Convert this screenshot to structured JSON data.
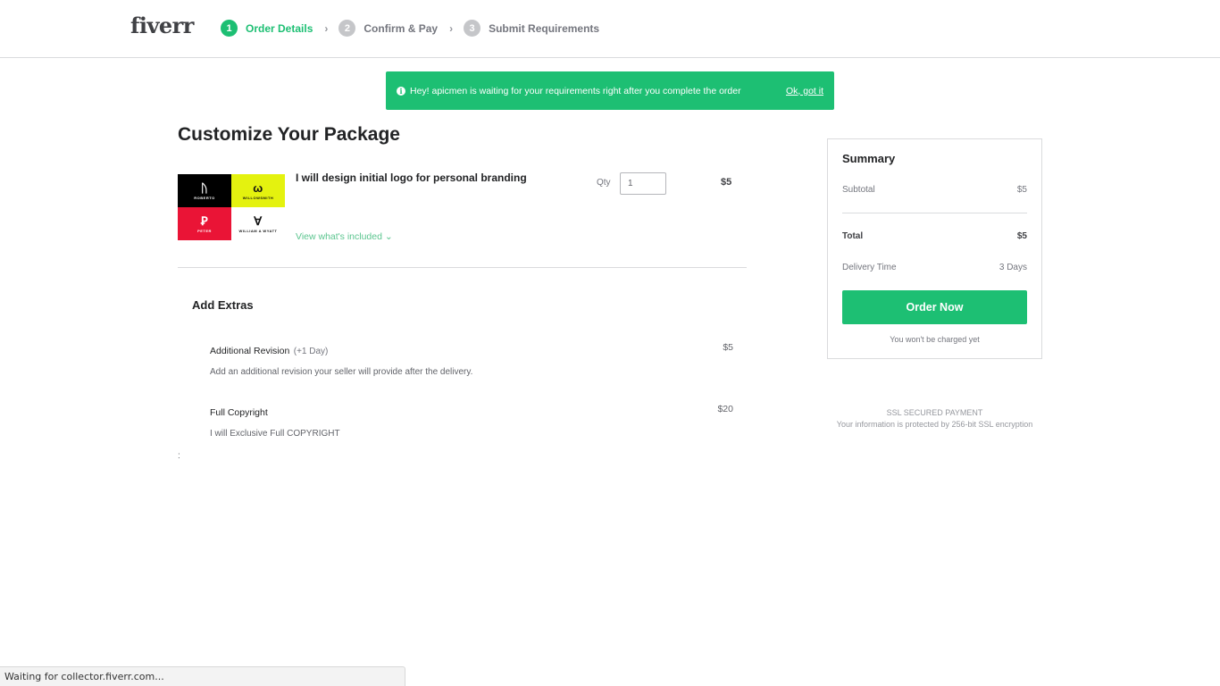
{
  "header": {
    "logo": "fiverr",
    "steps": [
      {
        "num": "1",
        "label": "Order Details",
        "active": true
      },
      {
        "num": "2",
        "label": "Confirm & Pay",
        "active": false
      },
      {
        "num": "3",
        "label": "Submit Requirements",
        "active": false
      }
    ],
    "chevron": "›"
  },
  "banner": {
    "icon": "i",
    "message": "Hey! apicmen is waiting for your requirements right after you complete the order",
    "dismiss_label": "Ok, got it"
  },
  "main": {
    "title": "Customize Your Package",
    "gig": {
      "title": "I will design initial logo for personal branding",
      "view_included_label": "View what's included ⌄",
      "qty_label": "Qty",
      "qty_value": "1",
      "price": "$5",
      "image_tiles": [
        {
          "glyph": "ᚢ",
          "caption": "ROBERTO",
          "bg": "#000000"
        },
        {
          "glyph": "ω",
          "caption": "WILLOWSMITH",
          "bg": "#e4f20f"
        },
        {
          "glyph": "Ꝑ",
          "caption": "PETER",
          "bg": "#ea1436"
        },
        {
          "glyph": "∀",
          "caption": "WILLIAM A WYATT",
          "bg": "#ffffff"
        }
      ]
    },
    "extras": {
      "title": "Add Extras",
      "items": [
        {
          "name": "Additional Revision",
          "note": "(+1 Day)",
          "price": "$5",
          "description": "Add an additional revision your seller will provide after the delivery."
        },
        {
          "name": "Full Copyright",
          "note": "",
          "price": "$20",
          "description": "I will Exclusive Full COPYRIGHT"
        }
      ]
    },
    "stray_text": ":"
  },
  "summary": {
    "title": "Summary",
    "subtotal_label": "Subtotal",
    "subtotal_value": "$5",
    "total_label": "Total",
    "total_value": "$5",
    "delivery_label": "Delivery Time",
    "delivery_value": "3 Days",
    "order_button": "Order Now",
    "no_charge_note": "You won't be charged yet"
  },
  "ssl": {
    "title": "SSL SECURED PAYMENT",
    "description": "Your information is protected by 256-bit SSL encryption"
  },
  "browser_status": "Waiting for collector.fiverr.com...",
  "colors": {
    "brand_green": "#1dbf73",
    "text_dark": "#222325",
    "text_muted": "#74767e"
  }
}
